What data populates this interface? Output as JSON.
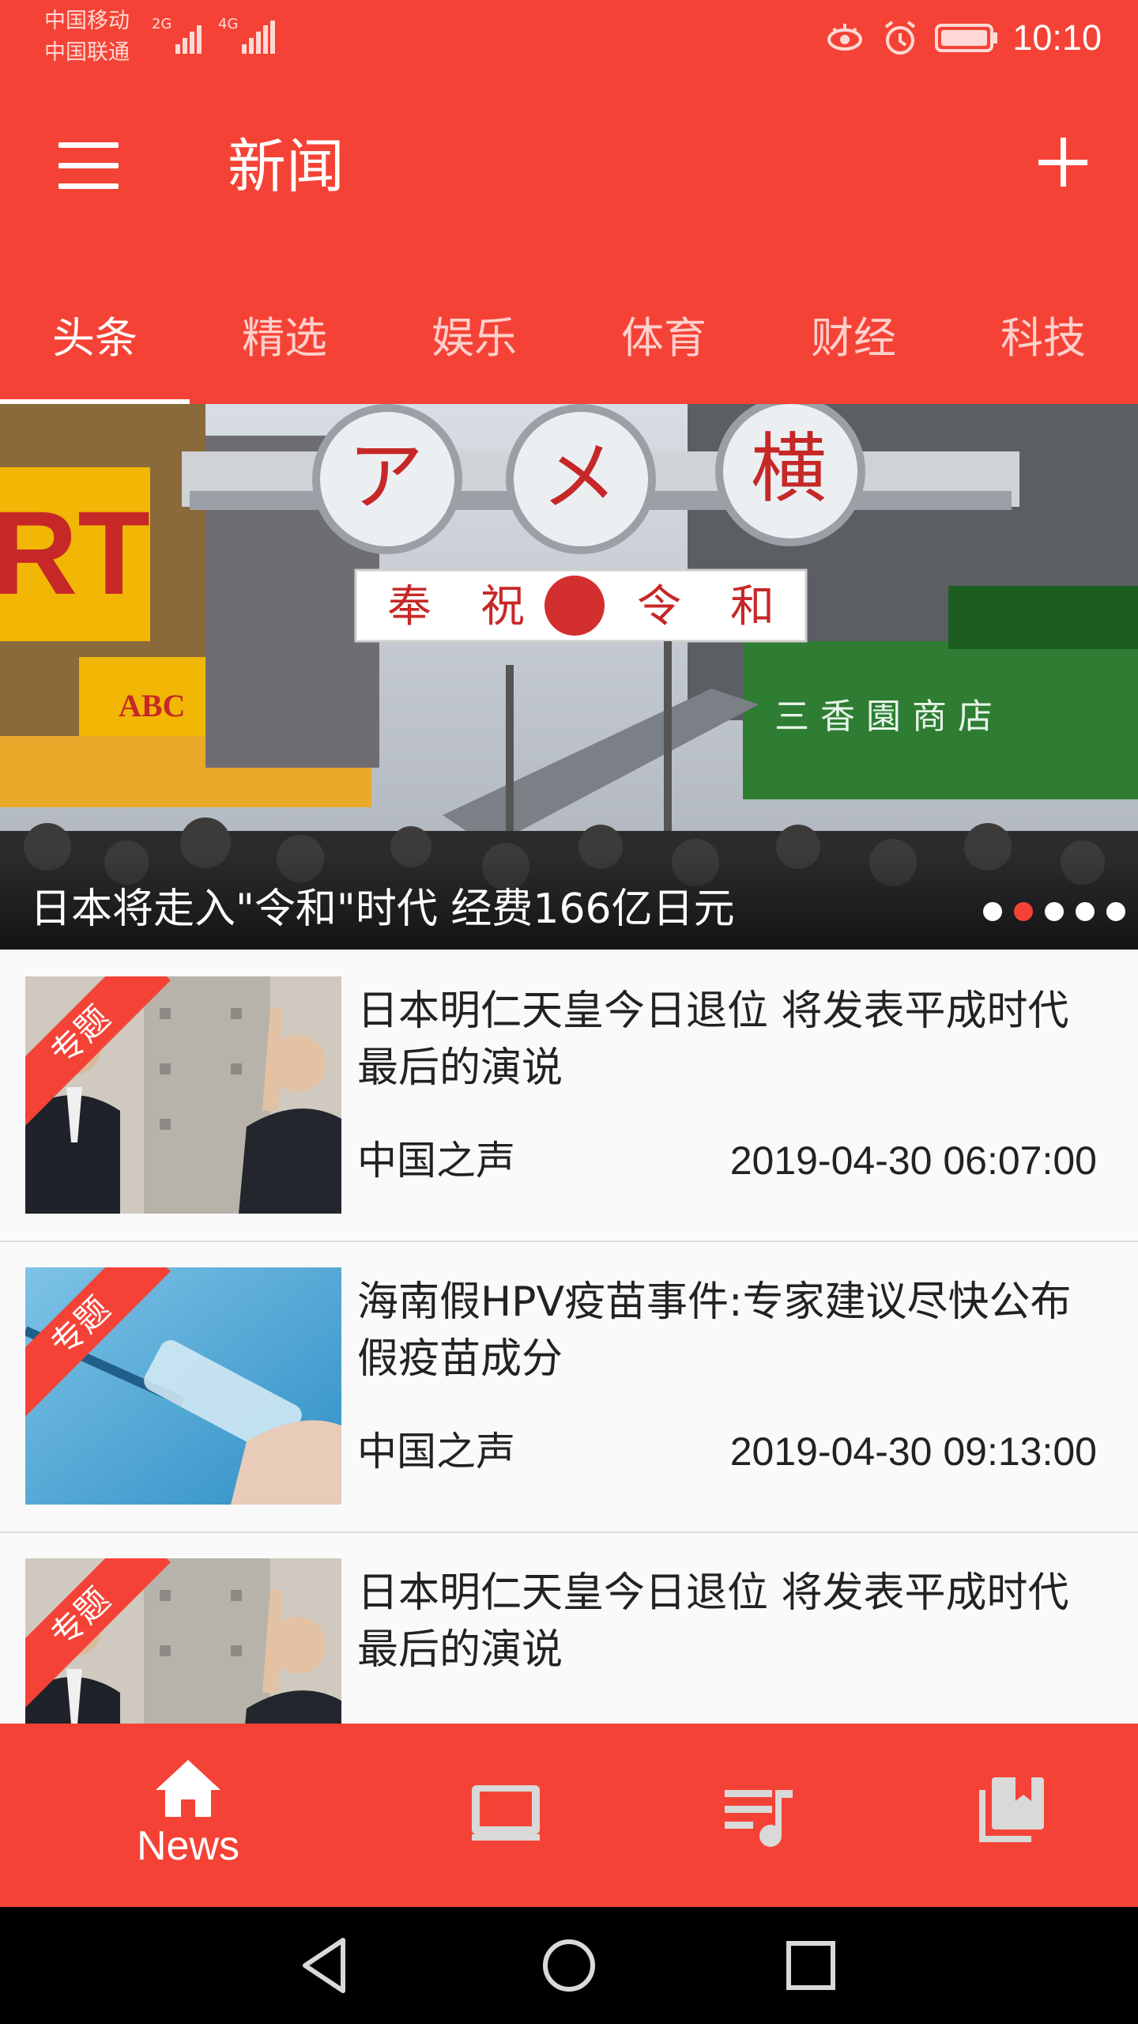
{
  "status_bar": {
    "carrier1": "中国移动",
    "carrier2": "中国联通",
    "signal1": "2G",
    "signal2": "4G",
    "time": "10:10"
  },
  "app_bar": {
    "title": "新闻"
  },
  "tabs": [
    {
      "label": "头条",
      "active": true
    },
    {
      "label": "精选"
    },
    {
      "label": "娱乐"
    },
    {
      "label": "体育"
    },
    {
      "label": "财经"
    },
    {
      "label": "科技"
    }
  ],
  "banner": {
    "caption": "日本将走入\"令和\"时代 经费166亿日元",
    "sign_chars": [
      "ア",
      "メ",
      "横"
    ],
    "banner_text": "奉祝 令和",
    "dots_count": 5,
    "active_dot": 1
  },
  "news": [
    {
      "tag": "专题",
      "title": "日本明仁天皇今日退位 将发表平成时代最后的演说",
      "source": "中国之声",
      "time": "2019-04-30 06:07:00",
      "image": "emperor"
    },
    {
      "tag": "专题",
      "title": "海南假HPV疫苗事件:专家建议尽快公布假疫苗成分",
      "source": "中国之声",
      "time": "2019-04-30 09:13:00",
      "image": "vaccine"
    },
    {
      "tag": "专题",
      "title": "日本明仁天皇今日退位 将发表平成时代最后的演说",
      "source": "",
      "time": "",
      "image": "emperor"
    }
  ],
  "bottom_nav": {
    "items": [
      {
        "label": "News",
        "icon": "home-icon"
      },
      {
        "label": "",
        "icon": "tv-icon"
      },
      {
        "label": "",
        "icon": "music-list-icon"
      },
      {
        "label": "",
        "icon": "library-icon"
      }
    ]
  },
  "colors": {
    "primary": "#f44336",
    "text": "#222222"
  }
}
